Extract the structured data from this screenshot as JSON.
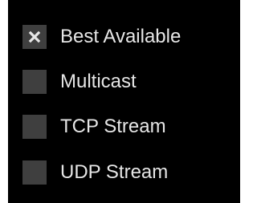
{
  "options": [
    {
      "label": "Best Available",
      "checked": true
    },
    {
      "label": "Multicast",
      "checked": false
    },
    {
      "label": "TCP Stream",
      "checked": false
    },
    {
      "label": "UDP Stream",
      "checked": false
    }
  ],
  "colors": {
    "panel_background": "#000000",
    "checkbox_fill": "#3f3f3f",
    "check_mark": "#e6e6e6",
    "label_text": "#e6e6e6"
  },
  "icons": {
    "checked_mark": "x-mark-icon"
  }
}
